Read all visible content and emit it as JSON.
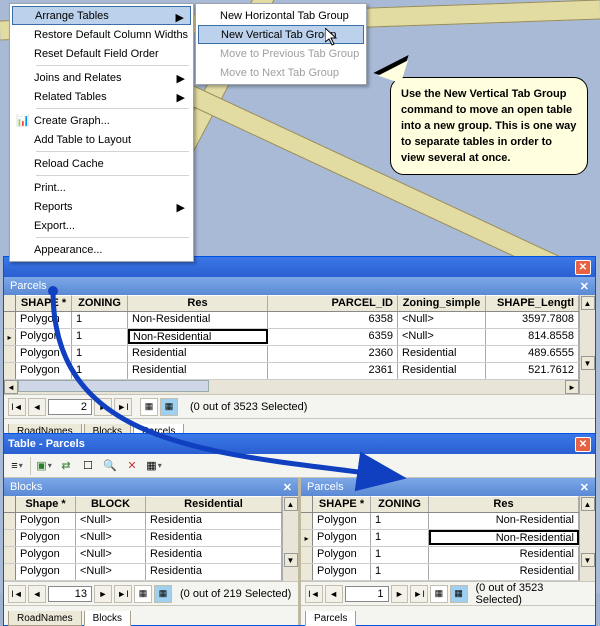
{
  "context_menu_1": {
    "items": [
      {
        "label": "Arrange Tables",
        "submenu": true,
        "hl": true
      },
      {
        "label": "Restore Default Column Widths"
      },
      {
        "label": "Reset Default Field Order"
      },
      {
        "sep": true
      },
      {
        "label": "Joins and Relates",
        "submenu": true
      },
      {
        "label": "Related Tables",
        "submenu": true
      },
      {
        "sep": true
      },
      {
        "label": "Create Graph...",
        "icon": "chart"
      },
      {
        "label": "Add Table to Layout"
      },
      {
        "sep": true
      },
      {
        "label": "Reload Cache"
      },
      {
        "sep": true
      },
      {
        "label": "Print..."
      },
      {
        "label": "Reports",
        "submenu": true
      },
      {
        "label": "Export..."
      },
      {
        "sep": true
      },
      {
        "label": "Appearance..."
      }
    ]
  },
  "context_menu_2": {
    "items": [
      {
        "label": "New Horizontal Tab Group"
      },
      {
        "label": "New Vertical Tab Group",
        "hl": true
      },
      {
        "label": "Move to Previous Tab Group",
        "disabled": true
      },
      {
        "label": "Move to Next Tab Group",
        "disabled": true
      }
    ]
  },
  "tooltip_text": "Use the New Vertical Tab Group command to move an open table into a new group.  This is one way to separate tables in order to view several at once.",
  "upper_table": {
    "inner_title": "Parcels",
    "columns": [
      "SHAPE *",
      "ZONING",
      "Res",
      "PARCEL_ID",
      "Zoning_simple",
      "SHAPE_Lengtl"
    ],
    "rows": [
      [
        "Polygon",
        "1",
        "Non-Residential",
        "6358",
        "<Null>",
        "3597.7808"
      ],
      [
        "Polygon",
        "1",
        "Non-Residential",
        "6359",
        "<Null>",
        "814.8558"
      ],
      [
        "Polygon",
        "1",
        "Residential",
        "2360",
        "Residential",
        "489.6555"
      ],
      [
        "Polygon",
        "1",
        "Residential",
        "2361",
        "Residential",
        "521.7612"
      ]
    ],
    "selected_cell_row": 1,
    "selected_cell_col": 2,
    "page": "2",
    "status": "(0 out of 3523 Selected)",
    "tabs": [
      "RoadNames",
      "Blocks",
      "Parcels"
    ],
    "active_tab": 2
  },
  "lower_title": "Table - Parcels",
  "lower_left": {
    "inner_title": "Blocks",
    "columns": [
      "Shape *",
      "BLOCK",
      "Residential"
    ],
    "rows": [
      [
        "Polygon",
        "<Null>",
        "Residentia"
      ],
      [
        "Polygon",
        "<Null>",
        "Residentia"
      ],
      [
        "Polygon",
        "<Null>",
        "Residentia"
      ],
      [
        "Polygon",
        "<Null>",
        "Residentia"
      ]
    ],
    "page": "13",
    "status": "(0 out of 219 Selected)",
    "tabs": [
      "RoadNames",
      "Blocks"
    ],
    "active_tab": 1
  },
  "lower_right": {
    "inner_title": "Parcels",
    "columns": [
      "SHAPE *",
      "ZONING",
      "Res"
    ],
    "rows": [
      [
        "Polygon",
        "1",
        "Non-Residential"
      ],
      [
        "Polygon",
        "1",
        "Non-Residential"
      ],
      [
        "Polygon",
        "1",
        "Residential"
      ],
      [
        "Polygon",
        "1",
        "Residential"
      ]
    ],
    "selected_cell_row": 1,
    "selected_cell_col": 2,
    "page": "1",
    "status": "(0 out of 3523 Selected)",
    "tabs": [
      "Parcels"
    ],
    "active_tab": 0
  }
}
